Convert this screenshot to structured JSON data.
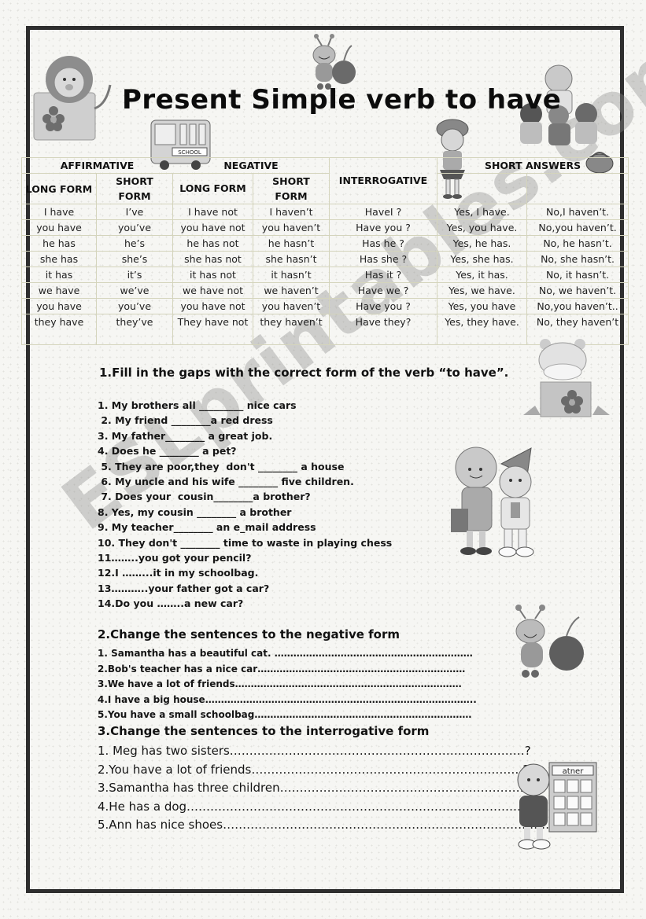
{
  "title": "Present Simple verb to have",
  "watermark": "ESLprintables.com",
  "table": {
    "group_headers": {
      "affirmative": "AFFIRMATIVE",
      "negative": "NEGATIVE",
      "interrogative": "INTERROGATIVE",
      "short_answers": "SHORT ANSWERS"
    },
    "sub_headers": {
      "aff_long": "LONG FORM",
      "aff_short": "SHORT FORM",
      "neg_long": "LONG FORM",
      "neg_short": "SHORT FORM"
    },
    "rows": [
      {
        "aff_long": "I have",
        "aff_short": "I’ve",
        "neg_long": "I have not",
        "neg_short": "I haven’t",
        "interrogative": "HaveI ?",
        "yes": "Yes, I have.",
        "no": "No,I haven’t."
      },
      {
        "aff_long": "you have",
        "aff_short": "you’ve",
        "neg_long": "you have not",
        "neg_short": "you haven’t",
        "interrogative": "Have you ?",
        "yes": "Yes, you have.",
        "no": "No,you haven’t."
      },
      {
        "aff_long": "he has",
        "aff_short": "he’s",
        "neg_long": "he has not",
        "neg_short": "he hasn’t",
        "interrogative": "Has he ?",
        "yes": "Yes, he has.",
        "no": "No, he hasn’t."
      },
      {
        "aff_long": "she has",
        "aff_short": "she’s",
        "neg_long": "she has not",
        "neg_short": "she hasn’t",
        "interrogative": "Has she ?",
        "yes": "Yes, she has.",
        "no": "No, she hasn’t."
      },
      {
        "aff_long": "it has",
        "aff_short": "it’s",
        "neg_long": "it has not",
        "neg_short": "it hasn’t",
        "interrogative": "Has it ?",
        "yes": "Yes, it has.",
        "no": "No, it hasn’t."
      },
      {
        "aff_long": "we have",
        "aff_short": "we’ve",
        "neg_long": "we have not",
        "neg_short": "we haven’t",
        "interrogative": "Have we ?",
        "yes": "Yes, we have.",
        "no": "No, we haven’t."
      },
      {
        "aff_long": "you have",
        "aff_short": "you’ve",
        "neg_long": "you have not",
        "neg_short": "you haven’t",
        "interrogative": "Have you ?",
        "yes": "Yes, you have",
        "no": "No,you haven’t.."
      },
      {
        "aff_long": "they have",
        "aff_short": "they’ve",
        "neg_long": "They have not",
        "neg_short": "they haven’t",
        "interrogative": "Have they?",
        "yes": "Yes, they have.",
        "no": "No, they haven’t"
      }
    ]
  },
  "exercise1": {
    "title": "1.Fill in the gaps with the correct form of the verb “to have”.",
    "items": [
      "1. My brothers all _________ nice cars",
      " 2. My friend ________a red dress",
      "3. My father________ a great job.",
      "4. Does he ________ a pet?",
      " 5. They are poor,they  don't ________ a house",
      " 6. My uncle and his wife ________ five children.",
      " 7. Does your  cousin________a brother?",
      "8. Yes, my cousin ________ a brother",
      "9. My teacher________ an e_mail address",
      "10. They don't ________ time to waste in playing chess",
      "11……..you got your pencil?",
      "12.I ……...it in my schoolbag.",
      "13………..your father got a car?",
      "14.Do you ……..a new car?"
    ]
  },
  "exercise2": {
    "title": "2.Change the sentences to the negative form",
    "items": [
      "1. Samantha has a beautiful cat. ………………………………………………………",
      "2.Bob's teacher has a nice car…………………………………………………………",
      "3.We have a lot of friends………………………………………………………………",
      "4.I have a big house…………………………………………………………………………..",
      "5.You have a small schoolbag……………………………………………………………"
    ]
  },
  "exercise3": {
    "title": "3.Change the sentences to the interrogative form",
    "items": [
      "1. Meg has two sisters…………………………………………………………………?",
      "2.You have a lot of friends……………………………………………………………?",
      "3.Samantha has three children………………………………………………………?",
      "4.He has a dog…………………………………………………………………………………?",
      "5.Ann has nice shoes…………………………………………………………………………?"
    ]
  },
  "clipart": {
    "calendar_label": "atner",
    "bus_label": "SCHOOL"
  }
}
